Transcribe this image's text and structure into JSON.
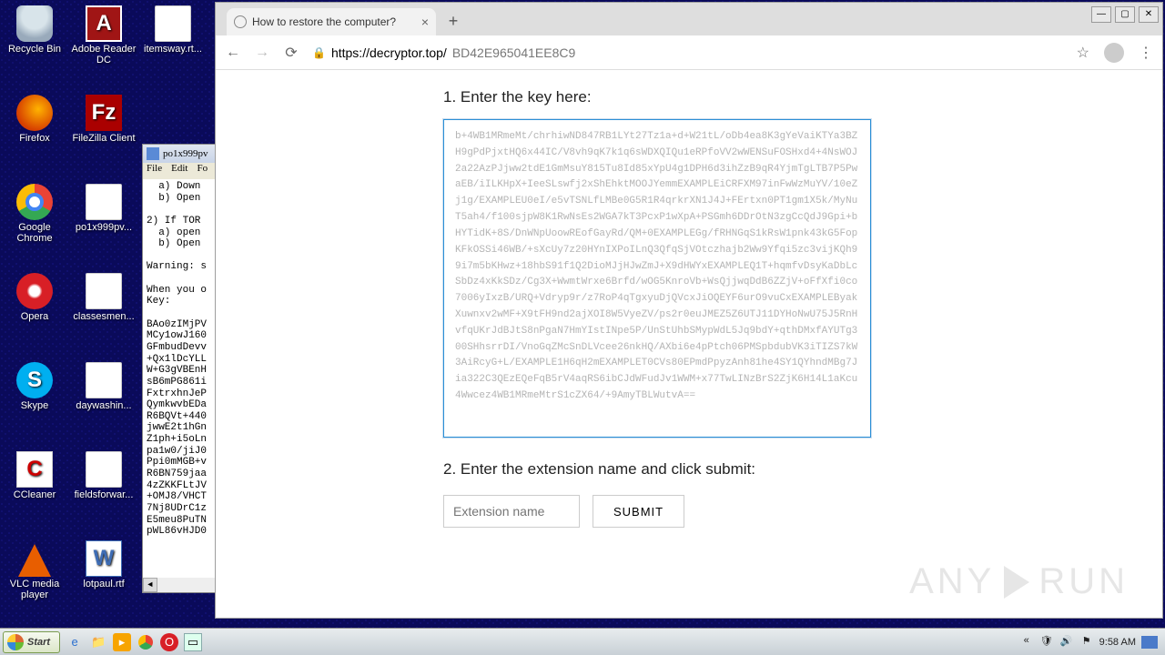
{
  "desktop": {
    "icons": [
      {
        "label": "Recycle Bin"
      },
      {
        "label": "Adobe Reader DC"
      },
      {
        "label": "itemsway.rt..."
      },
      {
        "label": "Firefox"
      },
      {
        "label": "FileZilla Client"
      },
      {
        "label": "Google Chrome"
      },
      {
        "label": "po1x999pv..."
      },
      {
        "label": "Opera"
      },
      {
        "label": "classesmen..."
      },
      {
        "label": "Skype"
      },
      {
        "label": "daywashin..."
      },
      {
        "label": "CCleaner"
      },
      {
        "label": "fieldsforwar..."
      },
      {
        "label": "VLC media player"
      },
      {
        "label": "lotpaul.rtf"
      }
    ]
  },
  "notepad": {
    "title": "po1x999pv",
    "menu": [
      "File",
      "Edit",
      "Fo"
    ],
    "body": "  a) Down\n  b) Open\n\n2) If TOR\n  a) open\n  b) Open\n\nWarning: s\n\nWhen you o\nKey:\n\nBAo0zIMjPV\nMCy1owJ160\nGFmbudDevv\n+Qx1lDcYLL\nW+G3gVBEnH\nsB6mPG861i\nFxtrxhnJeP\nQymkwvbEDa\nR6BQVt+440\njwwE2t1hGn\nZ1ph+i5oLn\npa1w0/jiJ0\nPpi0mMGB+v\nR6BN759jaa\n4zZKKFLtJV\n+OMJ8/VHCT\n7Nj8UDrC1z\nE5meu8PuTN\npWL86vHJD0"
  },
  "browser": {
    "tab_title": "How to restore the computer?",
    "url": {
      "host": "https://decryptor.top/",
      "path": "BD42E965041EE8C9"
    },
    "win_controls": {
      "min": "—",
      "max": "▢",
      "close": "✕"
    },
    "page": {
      "step1": "1. Enter the key here:",
      "key_text": "b+4WB1MRmeMt/chrhiwND847RB1LYt27Tz1a+d+W21tL/oDb4ea8K3gYeVaiKTYa3BZH9gPdPjxtHQ6x44IC/V8vh9qK7k1q6sWDXQIQu1eRPfoVV2wWENSuFOSHxd4+4NsWOJ2a22AzPJjww2tdE1GmMsuY815Tu8Id85xYpU4g1DPH6d3ihZzB9qR4YjmTgLTB7P5PwaEB/iILKHpX+IeeSLswfj2xShEhktMOOJYemmEXAMPLEiCRFXM97inFwWzMuYV/10eZj1g/EXAMPLEU0eI/e5vTSNLfLMBe0G5R1R4qrkrXN1J4J+FErtxn0PT1gm1X5k/MyNuT5ah4/f100sjpW8K1RwNsEs2WGA7kT3PcxP1wXpA+PSGmh6DDrOtN3zgCcQdJ9Gpi+bHYTidK+8S/DnWNpUoowREofGayRd/QM+0EXAMPLEGg/fRHNGqS1kRsW1pnk43kG5FopKFkOSSi46WB/+sXcUy7z20HYnIXPoILnQ3QfqSjVOtczhajb2Ww9Yfqi5zc3vijKQh99i7m5bKHwz+18hbS91f1Q2DioMJjHJwZmJ+X9dHWYxEXAMPLEQ1T+hqmfvDsyKaDbLcSbDz4xKkSDz/Cg3X+WwmtWrxe6Brfd/wOG5KnroVb+WsQjjwqDdB6ZZjV+oFfXfi0co7006yIxzB/URQ+Vdryp9r/z7RoP4qTgxyuDjQVcxJiOQEYF6urO9vuCxEXAMPLEByakXuwnxv2wMF+X9tFH9nd2ajXOI8W5VyeZV/ps2r0euJMEZ5Z6UTJ11DYHoNwU75J5RnHvfqUKrJdBJtS8nPgaN7HmYIstINpe5P/UnStUhbSMypWdL5Jq9bdY+qthDMxfAYUTg300SHhsrrDI/VnoGqZMcSnDLVcee26nkHQ/AXbi6e4pPtch06PMSpbdubVK3iTIZS7kW3AiRcyG+L/EXAMPLE1H6qH2mEXAMPLET0CVs80EPmdPpyzAnh81he4SY1QYhndMBg7Jia322C3QEzEQeFqB5rV4aqRS6ibCJdWFudJv1WWM+x77TwLINzBrS2ZjK6H14L1aKcu4Wwcez4WB1MRmeMtrS1cZX64/+9AmyTBLWutvA==",
      "step2": "2. Enter the extension name and click submit:",
      "ext_placeholder": "Extension name",
      "submit_label": "SUBMIT"
    }
  },
  "taskbar": {
    "start": "Start",
    "clock": "9:58 AM"
  },
  "watermark": {
    "text_a": "ANY",
    "text_b": "RUN"
  }
}
